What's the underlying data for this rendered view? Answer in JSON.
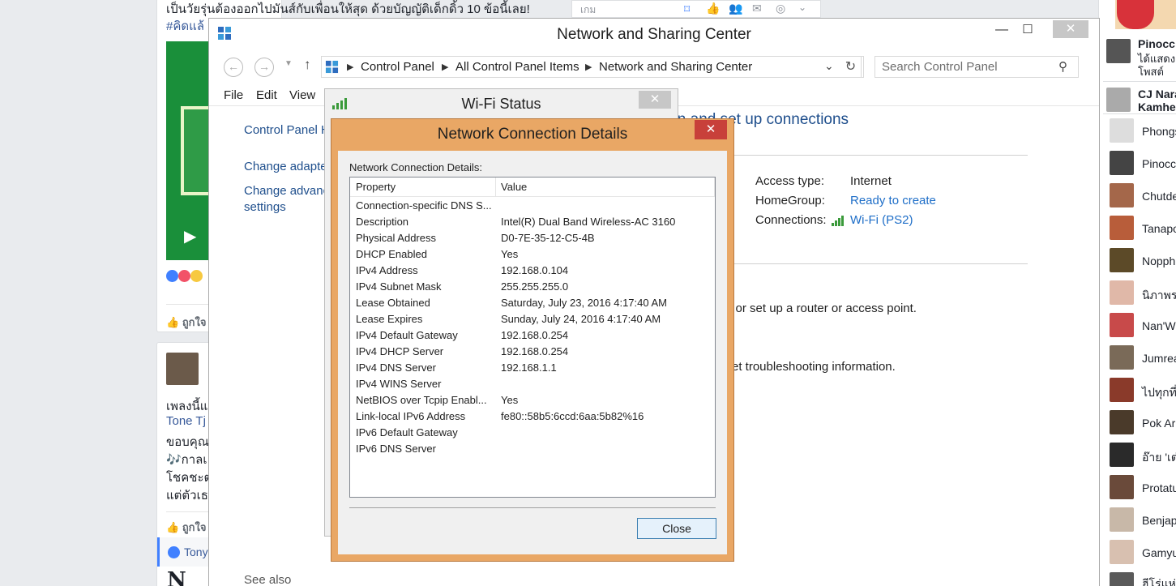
{
  "background": {
    "post1_text": "เป็นวัยรุ่นต้องออกไปมันส์กับเพื่อนให้สุด ด้วยบัญญัติเด็กดิ้ว 10 ข้อนี้เลย!",
    "post1_hashtag": "#คิดแล้",
    "like_label": "ถูกใจ",
    "top_search_text": "เกม",
    "post2_lines": [
      "เพลงนี้แ",
      "Tone Tj",
      "ขอบคุณ",
      "🎶กาลเ",
      "โชคชะต",
      "แต่ตัวเธ"
    ],
    "comment_name": "Tony",
    "chat": [
      {
        "name": "Pinocc",
        "sub1": "ได้แสดง",
        "sub2": "โพสต์"
      },
      {
        "name": "CJ Nara",
        "sub1": "Kamhe",
        "sub2": ""
      },
      {
        "name": "Phongs"
      },
      {
        "name": "Pinocc"
      },
      {
        "name": "Chutde"
      },
      {
        "name": "Tanapo"
      },
      {
        "name": "Nopph"
      },
      {
        "name": "นิภาพร"
      },
      {
        "name": "Nan'W"
      },
      {
        "name": "Jumrea"
      },
      {
        "name": "ไปทุกที่"
      },
      {
        "name": "Pok Ar"
      },
      {
        "name": "อ๊าย 'เต๋"
      },
      {
        "name": "Protatu"
      },
      {
        "name": "Benjap"
      },
      {
        "name": "Gamyu"
      },
      {
        "name": "ฮีโร่แห่"
      }
    ]
  },
  "nsc": {
    "title": "Network and Sharing Center",
    "breadcrumbs": [
      "Control Panel",
      "All Control Panel Items",
      "Network and Sharing Center"
    ],
    "search_placeholder": "Search Control Panel",
    "menu": [
      "File",
      "Edit",
      "View"
    ],
    "left_links": [
      "Control Panel H",
      "Change adapte",
      "Change advanc",
      "settings"
    ],
    "heading_partial": "ion and set up connections",
    "access_type_label": "Access type:",
    "access_type_value": "Internet",
    "homegroup_label": "HomeGroup:",
    "homegroup_value": "Ready to create",
    "connections_label": "Connections:",
    "connections_value": "Wi-Fi (PS2)",
    "text_router": "tion; or set up a router or access point.",
    "text_troubleshoot": "et troubleshooting information.",
    "see_also": "See also"
  },
  "wifi_status": {
    "title": "Wi-Fi Status"
  },
  "details": {
    "title": "Network Connection Details",
    "label": "Network Connection Details:",
    "col_property": "Property",
    "col_value": "Value",
    "rows": [
      {
        "p": "Connection-specific DNS S...",
        "v": ""
      },
      {
        "p": "Description",
        "v": "Intel(R) Dual Band Wireless-AC 3160"
      },
      {
        "p": "Physical Address",
        "v": "D0-7E-35-12-C5-4B"
      },
      {
        "p": "DHCP Enabled",
        "v": "Yes"
      },
      {
        "p": "IPv4 Address",
        "v": "192.168.0.104"
      },
      {
        "p": "IPv4 Subnet Mask",
        "v": "255.255.255.0"
      },
      {
        "p": "Lease Obtained",
        "v": "Saturday, July 23, 2016 4:17:40 AM"
      },
      {
        "p": "Lease Expires",
        "v": "Sunday, July 24, 2016 4:17:40 AM"
      },
      {
        "p": "IPv4 Default Gateway",
        "v": "192.168.0.254"
      },
      {
        "p": "IPv4 DHCP Server",
        "v": "192.168.0.254"
      },
      {
        "p": "IPv4 DNS Server",
        "v": "192.168.1.1"
      },
      {
        "p": "IPv4 WINS Server",
        "v": ""
      },
      {
        "p": "NetBIOS over Tcpip Enabl...",
        "v": "Yes"
      },
      {
        "p": "Link-local IPv6 Address",
        "v": "fe80::58b5:6ccd:6aa:5b82%16"
      },
      {
        "p": "IPv6 Default Gateway",
        "v": ""
      },
      {
        "p": "IPv6 DNS Server",
        "v": ""
      }
    ],
    "close_label": "Close"
  },
  "colors": {
    "dialog_frame": "#e9a765",
    "close_red": "#c8403a",
    "link_blue": "#1e4e8c"
  }
}
